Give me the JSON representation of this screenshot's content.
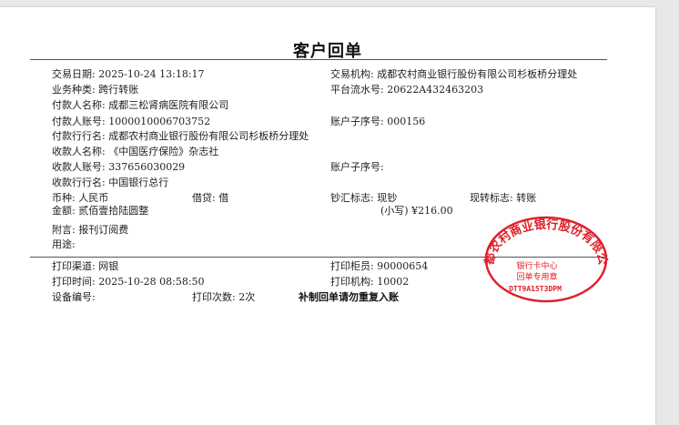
{
  "title": "客户回单",
  "fields": {
    "trade_date": "交易日期: 2025-10-24 13:18:17",
    "trade_org": "交易机构: 成都农村商业银行股份有限公司杉板桥分理处",
    "biz_type": "业务种类: 跨行转账",
    "serial_no": "平台流水号: 20622A432463203",
    "payer_name": "付款人名称: 成都三松肾病医院有限公司",
    "payer_account": "付款人账号: 1000010006703752",
    "payer_sub": "账户子序号: 000156",
    "payer_bank": "付款行行名: 成都农村商业银行股份有限公司杉板桥分理处",
    "payee_name": "收款人名称: 《中国医疗保险》杂志社",
    "payee_account": "收款人账号: 337656030029",
    "payee_sub": "账户子序号:",
    "payee_bank": "收款行行名: 中国银行总行",
    "currency": "币种: 人民币",
    "debit_credit": "借贷: 借",
    "cash_flag": "钞汇标志: 现钞",
    "transfer_flag": "现转标志: 转账",
    "amount_upper": "金额: 贰佰壹拾陆圆整",
    "amount_lower": "(小写) ¥216.00",
    "memo": "附言: 报刊订阅费",
    "usage": "用途:",
    "print_channel": "打印渠道: 网银",
    "print_teller": "打印柜员: 90000654",
    "print_time": "打印时间: 2025-10-28 08:58:50",
    "print_org": "打印机构: 10002",
    "device_no": "设备编号:",
    "print_count": "打印次数: 2次",
    "warning": "补制回单请勿重复入账"
  },
  "seal": {
    "arc_text": "成都农村商业银行股份有限公司",
    "line1": "银行卡中心",
    "line2": "回单专用章",
    "code": "DTT9A15T3DPM",
    "color": "#e0202a"
  }
}
